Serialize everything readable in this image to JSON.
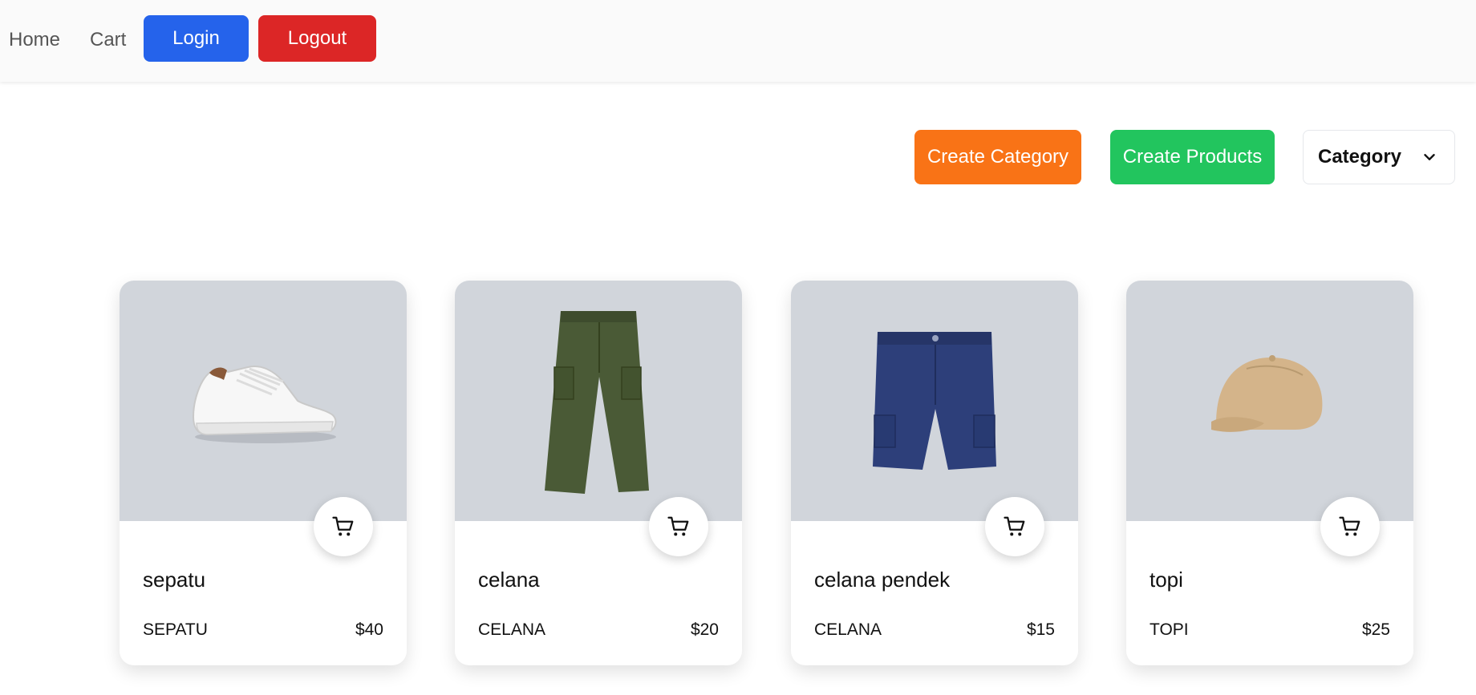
{
  "nav": {
    "home": "Home",
    "cart": "Cart",
    "login": "Login",
    "logout": "Logout"
  },
  "actions": {
    "create_category": "Create Category",
    "create_products": "Create Products",
    "category_select": "Category"
  },
  "colors": {
    "login": "#2563eb",
    "logout": "#dc2626",
    "create_category": "#f97316",
    "create_products": "#22c55e",
    "image_bg": "#d1d5db"
  },
  "products": [
    {
      "name": "sepatu",
      "category": "SEPATU",
      "price": "$40",
      "image": "white-sneaker"
    },
    {
      "name": "celana",
      "category": "CELANA",
      "price": "$20",
      "image": "green-cargo-pants"
    },
    {
      "name": "celana pendek",
      "category": "CELANA",
      "price": "$15",
      "image": "navy-cargo-shorts"
    },
    {
      "name": "topi",
      "category": "TOPI",
      "price": "$25",
      "image": "beige-cap"
    }
  ]
}
